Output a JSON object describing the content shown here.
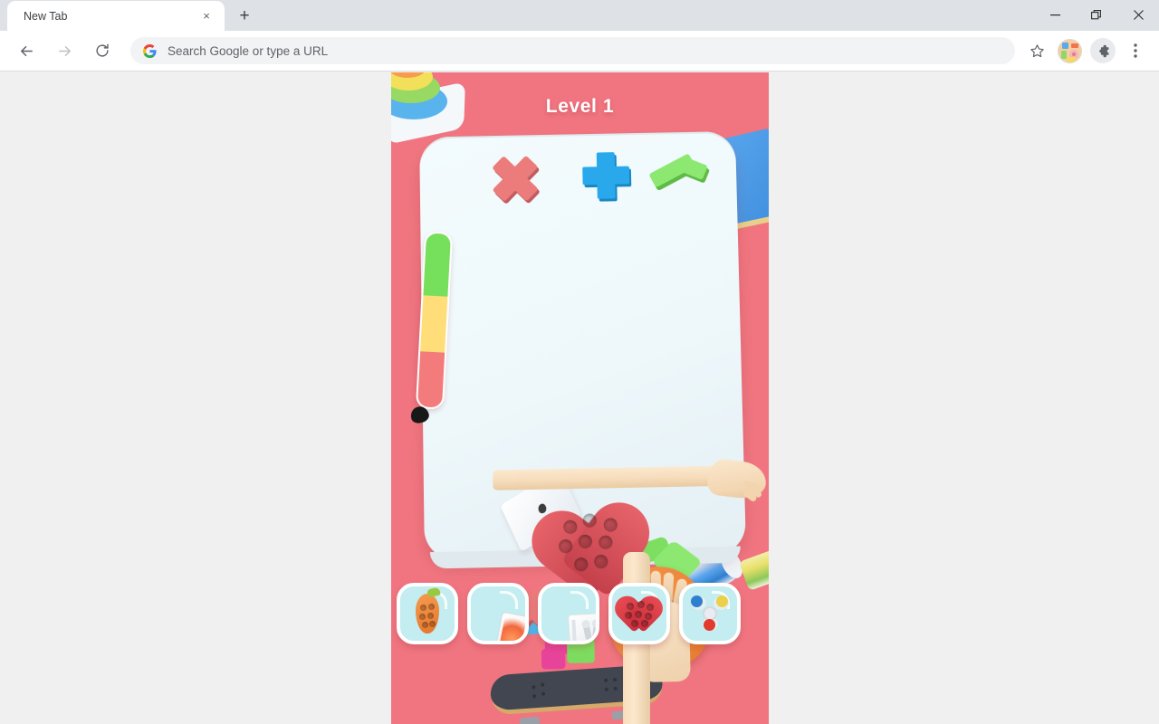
{
  "browser": {
    "tab": {
      "title": "New Tab",
      "close_label": "×"
    },
    "new_tab_button": "+",
    "window_controls": {
      "minimize": "minimize-icon",
      "maximize": "maximize-icon",
      "close": "close-icon"
    },
    "nav": {
      "back": "back-arrow-icon",
      "forward": "forward-arrow-icon",
      "reload": "reload-icon"
    },
    "omnibox": {
      "placeholder": "Search Google or type a URL",
      "value": "",
      "search_engine_icon": "google-g-icon"
    },
    "toolbar_right": {
      "bookmark": "star-icon",
      "profile": "avatar-icon",
      "extensions": "puzzle-piece-icon",
      "menu": "three-dot-menu-icon"
    }
  },
  "game": {
    "title": "Level 1",
    "background_color": "#f07580",
    "card_color": "#eef8fb",
    "timer": {
      "segments": [
        {
          "name": "green",
          "color": "#76e05c",
          "pct": 36
        },
        {
          "name": "yellow",
          "color": "#ffde79",
          "pct": 32
        },
        {
          "name": "red",
          "color": "#f47b7b",
          "pct": 32
        }
      ],
      "tip": "pencil-tip"
    },
    "target_shapes": [
      {
        "name": "x-shape",
        "color": "#ec7b7b"
      },
      {
        "name": "plus-shape",
        "color": "#29a9ec"
      },
      {
        "name": "l-shape",
        "color": "#8ce870"
      }
    ],
    "board_items": [
      {
        "name": "heart-popit",
        "color": "#d8545c"
      },
      {
        "name": "carrot-popit",
        "color": "#ef8a3c"
      },
      {
        "name": "laptop",
        "color": "#ffffff"
      },
      {
        "name": "lego-blocks",
        "colors": [
          "#4fb7ea",
          "#e8439a",
          "#7ddc5f",
          "#f9d64a"
        ]
      },
      {
        "name": "x-shape-small",
        "color": "#ec7b7b"
      },
      {
        "name": "green-wedge",
        "color": "#8ce870"
      }
    ],
    "scene_props": [
      {
        "name": "stacking-rings-toy",
        "colors": [
          "#f79b4e",
          "#f2e05a",
          "#97d963",
          "#59b3ec"
        ]
      },
      {
        "name": "blue-book",
        "color": "#4f9dea"
      },
      {
        "name": "blue-cup",
        "color": "#5aa7ef"
      },
      {
        "name": "yellow-cup",
        "color": "#e9e06a"
      },
      {
        "name": "skateboard",
        "color": "#414651"
      }
    ],
    "tray": {
      "items": [
        {
          "name": "carrot-popit-card",
          "icon": "carrot-popit-icon",
          "label": "Carrot Pop It"
        },
        {
          "name": "phone-box-card",
          "icon": "phone-box-icon",
          "label": "Phone Box"
        },
        {
          "name": "earbuds-box-card",
          "icon": "earbuds-box-icon",
          "label": "Earbuds Box"
        },
        {
          "name": "heart-popit-card",
          "icon": "heart-popit-icon",
          "label": "Heart Pop It"
        },
        {
          "name": "spinner-card",
          "icon": "fidget-spinner-icon",
          "label": "Fidget Spinner"
        }
      ],
      "card_color": "#c3edf0"
    }
  }
}
